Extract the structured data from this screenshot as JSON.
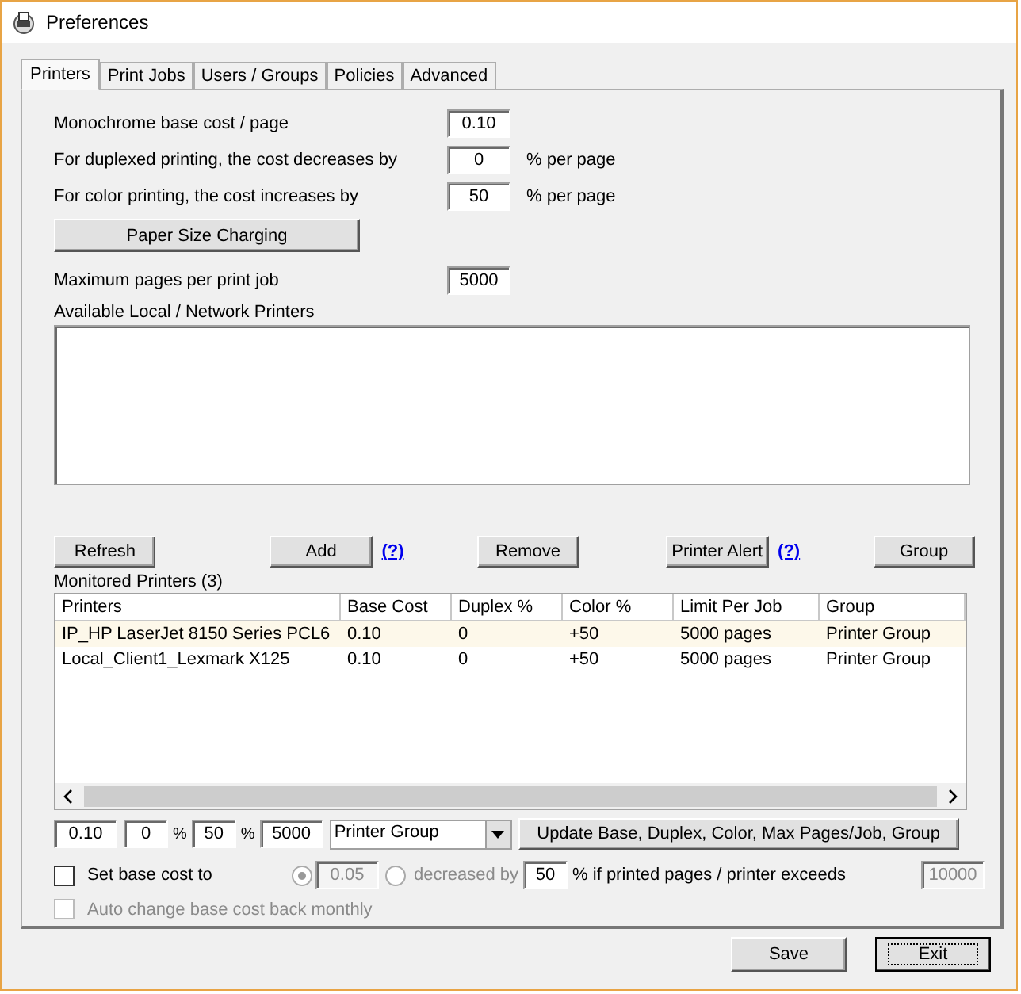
{
  "window": {
    "title": "Preferences"
  },
  "tabs": [
    {
      "label": "Printers",
      "selected": true
    },
    {
      "label": "Print Jobs",
      "selected": false
    },
    {
      "label": "Users / Groups",
      "selected": false
    },
    {
      "label": "Policies",
      "selected": false
    },
    {
      "label": "Advanced",
      "selected": false
    }
  ],
  "settings": [
    {
      "label": "Monochrome base cost / page",
      "value": "0.10"
    },
    {
      "label": "For duplexed printing, the cost decreases by",
      "value": "0",
      "unit": "% per page"
    },
    {
      "label": "For color printing, the cost increases by",
      "value": "50",
      "unit": "% per page"
    }
  ],
  "paper_size_button": "Paper Size Charging",
  "max_pages": {
    "label": "Maximum pages per print job",
    "value": "5000"
  },
  "available_printers": {
    "label": "Available Local / Network Printers"
  },
  "actions": [
    {
      "kind": "button",
      "label": "Refresh"
    },
    {
      "kind": "button",
      "label": "Add"
    },
    {
      "kind": "help",
      "label": "(?)"
    },
    {
      "kind": "button",
      "label": "Remove"
    },
    {
      "kind": "button",
      "label": "Printer Alert"
    },
    {
      "kind": "help",
      "label": "(?)"
    },
    {
      "kind": "button",
      "label": "Group"
    }
  ],
  "monitored": {
    "label": "Monitored Printers (3)",
    "columns": [
      "Printers",
      "Base Cost",
      "Duplex %",
      "Color %",
      "Limit Per Job",
      "Group"
    ],
    "rows": [
      {
        "cells": [
          "IP_HP LaserJet 8150 Series PCL6",
          "0.10",
          "0",
          "+50",
          "5000 pages",
          "Printer Group"
        ],
        "selected": true
      },
      {
        "cells": [
          "Local_Client1_Lexmark X125",
          "0.10",
          "0",
          "+50",
          "5000 pages",
          "Printer Group"
        ],
        "selected": false
      }
    ]
  },
  "edit_row": {
    "base": "0.10",
    "duplex": "0",
    "percent_1": "%",
    "color_pct": "50",
    "percent_2": "%",
    "max": "5000",
    "group": "Printer Group",
    "update_button": "Update Base, Duplex, Color, Max Pages/Job, Group"
  },
  "threshold": {
    "checkbox": {
      "label": "Set base cost to",
      "checked": false,
      "disabled": false
    },
    "radio_1": {
      "selected": true,
      "disabled": true
    },
    "base_value": {
      "value": "0.05",
      "disabled": true
    },
    "radio_2": {
      "label": "decreased by",
      "selected": false,
      "disabled": true
    },
    "decrease_value": {
      "value": "50",
      "disabled": false
    },
    "condition": "% if printed pages / printer exceeds",
    "limit": {
      "value": "10000",
      "disabled": true
    }
  },
  "auto_change": {
    "label": "Auto change base cost back monthly",
    "checked": false,
    "disabled": true
  },
  "footer": [
    {
      "label": "Save",
      "focused": false
    },
    {
      "label": "Exit",
      "focused": true
    }
  ]
}
